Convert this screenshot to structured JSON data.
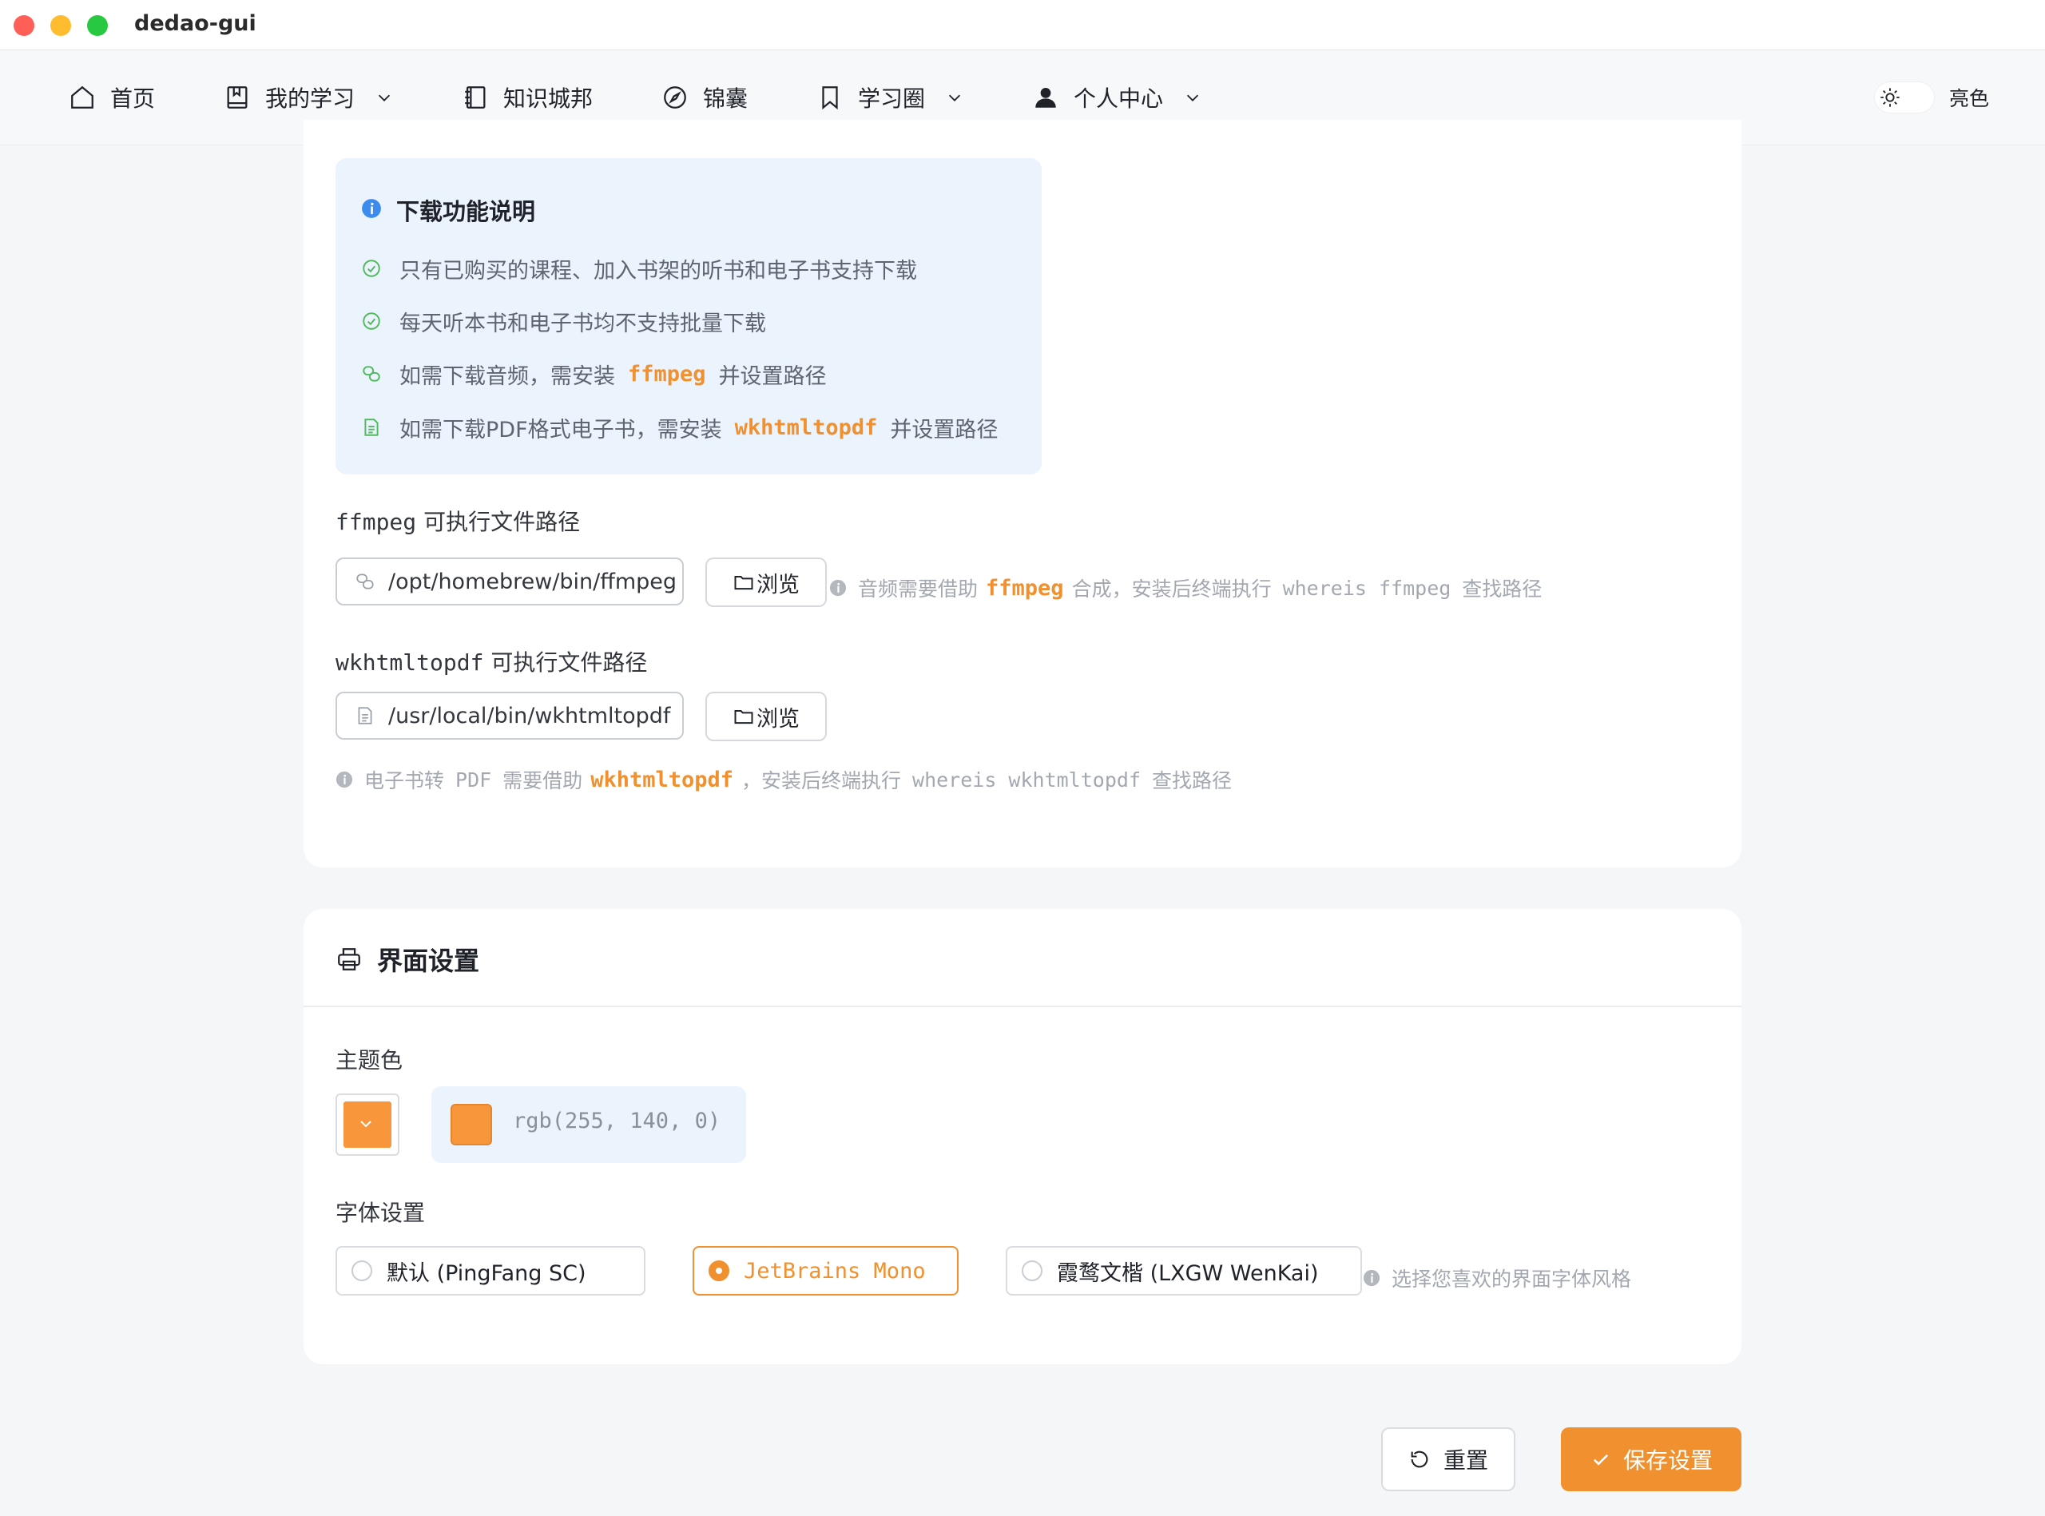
{
  "window": {
    "title": "dedao-gui"
  },
  "nav": {
    "home": "首页",
    "my_learning": "我的学习",
    "knowledge_city": "知识城邦",
    "jinnang": "锦囊",
    "study_circle": "学习圈",
    "personal_center": "个人中心",
    "theme_label": "亮色"
  },
  "download_info": {
    "title": "下载功能说明",
    "rows": [
      {
        "text": "只有已购买的课程、加入书架的听书和电子书支持下载"
      },
      {
        "text": "每天听本书和电子书均不支持批量下载"
      },
      {
        "prefix": "如需下载音频，需安装",
        "code": "ffmpeg",
        "suffix": "并设置路径"
      },
      {
        "prefix": "如需下载PDF格式电子书，需安装",
        "code": "wkhtmltopdf",
        "suffix": "并设置路径"
      }
    ]
  },
  "ffmpeg": {
    "label_code": "ffmpeg",
    "label_text": "可执行文件路径",
    "value": "/opt/homebrew/bin/ffmpeg",
    "browse": "浏览",
    "hint_prefix": "音频需要借助",
    "hint_code": "ffmpeg",
    "hint_mid": "合成，安装后终端执行",
    "hint_cmd": "whereis ffmpeg",
    "hint_suffix": "查找路径"
  },
  "wkhtmltopdf": {
    "label_code": "wkhtmltopdf",
    "label_text": "可执行文件路径",
    "value": "/usr/local/bin/wkhtmltopdf",
    "browse": "浏览",
    "hint_prefix1": "电子书转",
    "hint_pdf": "PDF",
    "hint_prefix2": "需要借助",
    "hint_code": "wkhtmltopdf",
    "hint_mid": "，安装后终端执行",
    "hint_cmd": "whereis wkhtmltopdf",
    "hint_suffix": "查找路径"
  },
  "ui_settings": {
    "title": "界面设置",
    "theme_color_label": "主题色",
    "theme_color_value": "rgb(255, 140, 0)",
    "font_label": "字体设置",
    "fonts": [
      {
        "label": "默认 (PingFang SC)",
        "selected": false
      },
      {
        "label": "JetBrains Mono",
        "selected": true
      },
      {
        "label": "霞鹜文楷 (LXGW WenKai)",
        "selected": false
      }
    ],
    "font_hint": "选择您喜欢的界面字体风格"
  },
  "actions": {
    "reset": "重置",
    "save": "保存设置"
  },
  "colors": {
    "accent": "#f0902f",
    "swatch": "#f7963a",
    "info_bg": "#ebf3fd",
    "success": "#52b95e"
  }
}
